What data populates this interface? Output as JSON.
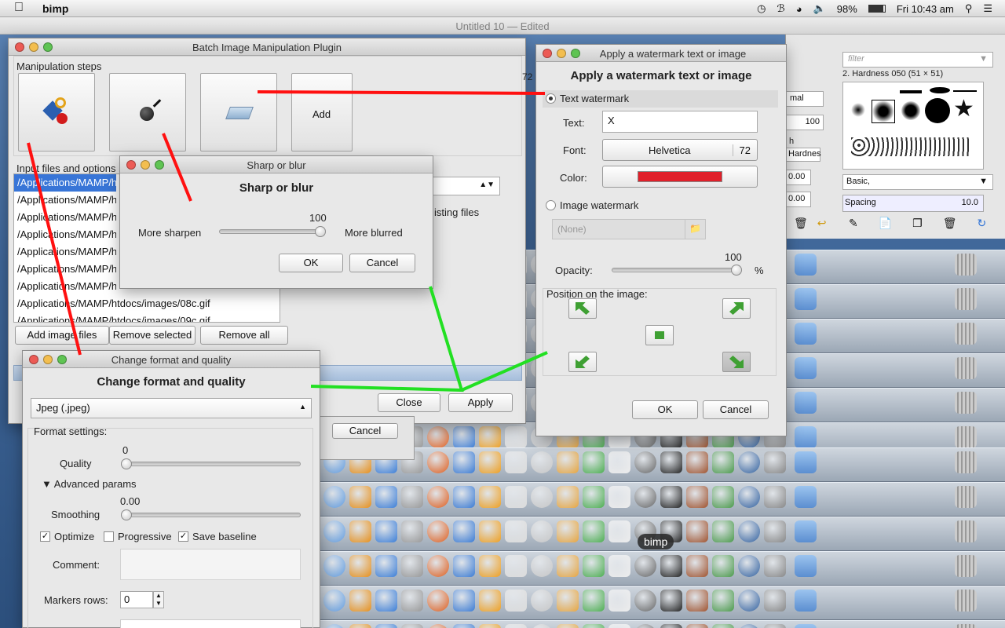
{
  "menubar": {
    "app_name": "bimp",
    "battery": "98%",
    "clock": "Fri 10:43 am"
  },
  "background_window": {
    "title": "Untitled 10 — Edited"
  },
  "gimp_brushes": {
    "filter_placeholder": "filter",
    "brush_name": "2. Hardness 050 (51 × 51)",
    "preset": "Basic,",
    "spacing_label": "Spacing",
    "spacing_value": "10.0",
    "mode_label": "mal",
    "value_100": "100",
    "h_label": "h",
    "hardness_label": "Hardnes",
    "val_a": "0.00",
    "val_b": "0.00"
  },
  "bimp_window": {
    "title": "Batch Image Manipulation Plugin",
    "steps_label": "Manipulation steps",
    "add_label": "Add",
    "input_label": "Input files and options",
    "files": [
      "/Applications/MAMP/h",
      "/Applications/MAMP/h",
      "/Applications/MAMP/h",
      "/Applications/MAMP/h",
      "/Applications/MAMP/h",
      "/Applications/MAMP/h",
      "/Applications/MAMP/h",
      "/Applications/MAMP/htdocs/images/08c.gif",
      "/Applications/MAMP/htdocs/images/09c.gif"
    ],
    "existing_files_label": "isting files",
    "add_images_btn": "Add image files",
    "remove_selected_btn": "Remove selected",
    "remove_all_btn": "Remove all",
    "close_btn": "Close",
    "apply_btn": "Apply",
    "cancel_btn": "Cancel",
    "partial_72": "72"
  },
  "sharp_blur": {
    "title": "Sharp or blur",
    "heading": "Sharp or blur",
    "value": "100",
    "left_label": "More sharpen",
    "right_label": "More blurred",
    "ok_btn": "OK",
    "cancel_btn": "Cancel"
  },
  "watermark": {
    "title": "Apply a watermark text or image",
    "heading": "Apply a watermark text or image",
    "text_radio": "Text watermark",
    "text_label": "Text:",
    "text_value": "X",
    "font_label": "Font:",
    "font_name": "Helvetica",
    "font_size": "72",
    "color_label": "Color:",
    "color_value": "#e0202a",
    "image_radio": "Image watermark",
    "image_placeholder": "(None)",
    "opacity_value": "100",
    "opacity_label": "Opacity:",
    "opacity_unit": "%",
    "position_label": "Position on the image:",
    "ok_btn": "OK",
    "cancel_btn": "Cancel"
  },
  "format_quality": {
    "title": "Change format and quality",
    "heading": "Change format and quality",
    "format": "Jpeg (.jpeg)",
    "settings_label": "Format settings:",
    "quality_value": "0",
    "quality_label": "Quality",
    "advanced_label": "Advanced params",
    "smoothing_value": "0.00",
    "smoothing_label": "Smoothing",
    "optimize_label": "Optimize",
    "progressive_label": "Progressive",
    "save_baseline_label": "Save baseline",
    "comment_label": "Comment:",
    "markers_label": "Markers rows:",
    "markers_value": "0"
  },
  "dock": {
    "tooltip": "bimp"
  },
  "colors": {
    "annotation_red": "#ff1010",
    "annotation_green": "#22e022",
    "watermark_color": "#e0202a"
  }
}
